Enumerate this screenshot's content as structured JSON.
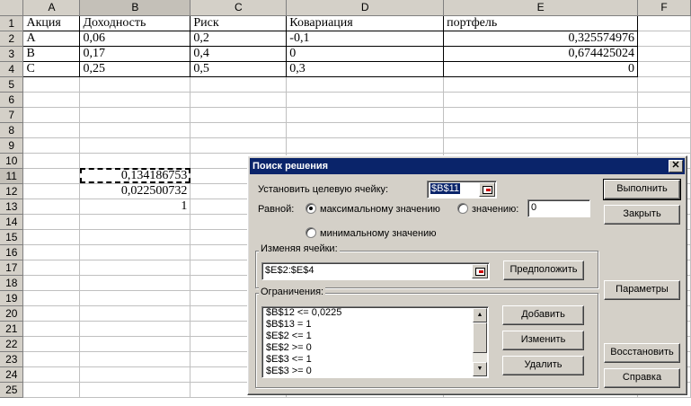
{
  "sheet": {
    "columns": [
      "A",
      "B",
      "C",
      "D",
      "E",
      "F"
    ],
    "rows": [
      {
        "n": "1",
        "cells": [
          "Акция",
          "Доходность",
          "Риск",
          "Ковариация",
          "портфель",
          ""
        ]
      },
      {
        "n": "2",
        "cells": [
          "A",
          "0,06",
          "0,2",
          "-0,1",
          "0,325574976",
          ""
        ]
      },
      {
        "n": "3",
        "cells": [
          "B",
          "0,17",
          "0,4",
          "0",
          "0,674425024",
          ""
        ]
      },
      {
        "n": "4",
        "cells": [
          "C",
          "0,25",
          "0,5",
          "0,3",
          "0",
          ""
        ]
      },
      {
        "n": "5",
        "cells": [
          "",
          "",
          "",
          "",
          "",
          ""
        ]
      },
      {
        "n": "6",
        "cells": [
          "",
          "",
          "",
          "",
          "",
          ""
        ]
      },
      {
        "n": "7",
        "cells": [
          "",
          "",
          "",
          "",
          "",
          ""
        ]
      },
      {
        "n": "8",
        "cells": [
          "",
          "",
          "",
          "",
          "",
          ""
        ]
      },
      {
        "n": "9",
        "cells": [
          "",
          "",
          "",
          "",
          "",
          ""
        ]
      },
      {
        "n": "10",
        "cells": [
          "",
          "",
          "",
          "",
          "",
          ""
        ]
      },
      {
        "n": "11",
        "cells": [
          "",
          "0,134186753",
          "",
          "",
          "",
          ""
        ]
      },
      {
        "n": "12",
        "cells": [
          "",
          "0,022500732",
          "",
          "",
          "",
          ""
        ]
      },
      {
        "n": "13",
        "cells": [
          "",
          "1",
          "",
          "",
          "",
          ""
        ]
      },
      {
        "n": "14",
        "cells": [
          "",
          "",
          "",
          "",
          "",
          ""
        ]
      },
      {
        "n": "15",
        "cells": [
          "",
          "",
          "",
          "",
          "",
          ""
        ]
      },
      {
        "n": "16",
        "cells": [
          "",
          "",
          "",
          "",
          "",
          ""
        ]
      },
      {
        "n": "17",
        "cells": [
          "",
          "",
          "",
          "",
          "",
          ""
        ]
      },
      {
        "n": "18",
        "cells": [
          "",
          "",
          "",
          "",
          "",
          ""
        ]
      },
      {
        "n": "19",
        "cells": [
          "",
          "",
          "",
          "",
          "",
          ""
        ]
      },
      {
        "n": "20",
        "cells": [
          "",
          "",
          "",
          "",
          "",
          ""
        ]
      },
      {
        "n": "21",
        "cells": [
          "",
          "",
          "",
          "",
          "",
          ""
        ]
      },
      {
        "n": "22",
        "cells": [
          "",
          "",
          "",
          "",
          "",
          ""
        ]
      },
      {
        "n": "23",
        "cells": [
          "",
          "",
          "",
          "",
          "",
          ""
        ]
      },
      {
        "n": "24",
        "cells": [
          "",
          "",
          "",
          "",
          "",
          ""
        ]
      },
      {
        "n": "25",
        "cells": [
          "",
          "",
          "",
          "",
          "",
          ""
        ]
      }
    ],
    "active_cell": "B11"
  },
  "dialog": {
    "title": "Поиск решения",
    "close_glyph": "✕",
    "target_label": "Установить целевую ячейку:",
    "target_value": "$B$11",
    "equal_label": "Равной:",
    "radio_max": "максимальному значению",
    "radio_value": "значению:",
    "value_input": "0",
    "radio_min": "минимальному значению",
    "changing_label": "Изменяя ячейки:",
    "changing_value": "$E$2:$E$4",
    "guess_button": "Предположить",
    "constraints_label": "Ограничения:",
    "constraints": [
      "$B$12 <= 0,0225",
      "$B$13 = 1",
      "$E$2 <= 1",
      "$E$2 >= 0",
      "$E$3 <= 1",
      "$E$3 >= 0"
    ],
    "add_button": "Добавить",
    "change_button": "Изменить",
    "delete_button": "Удалить",
    "solve_button": "Выполнить",
    "close_button": "Закрыть",
    "options_button": "Параметры",
    "reset_button": "Восстановить",
    "help_button": "Справка",
    "selected_radio": "max",
    "scroll_up_glyph": "▲",
    "scroll_down_glyph": "▼"
  }
}
